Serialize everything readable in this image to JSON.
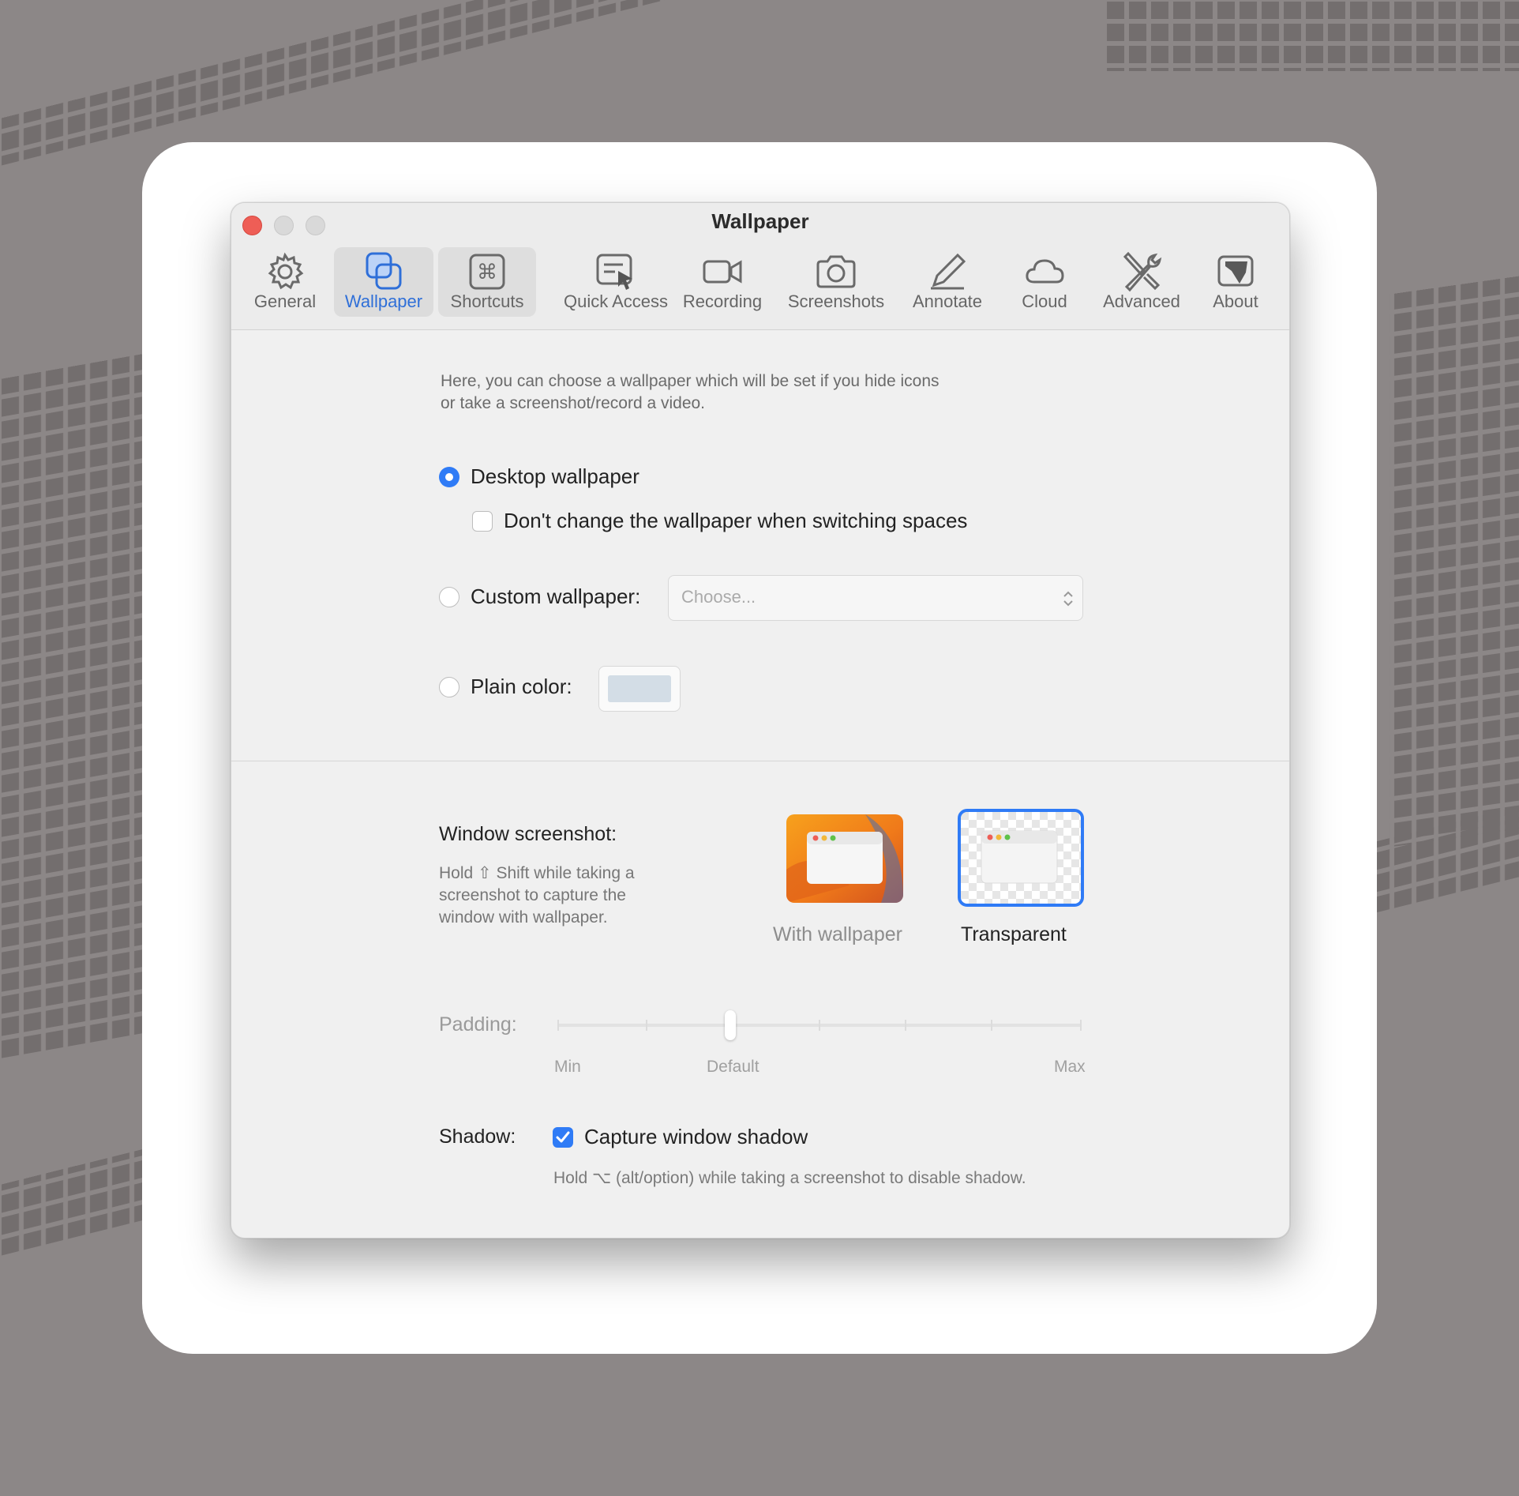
{
  "window": {
    "title": "Wallpaper"
  },
  "tabs": [
    {
      "label": "General",
      "icon": "gear-icon"
    },
    {
      "label": "Wallpaper",
      "icon": "wallpaper-icon",
      "active": true
    },
    {
      "label": "Shortcuts",
      "icon": "command-key-icon"
    },
    {
      "label": "Quick Access",
      "icon": "quick-access-icon"
    },
    {
      "label": "Recording",
      "icon": "video-camera-icon"
    },
    {
      "label": "Screenshots",
      "icon": "camera-icon"
    },
    {
      "label": "Annotate",
      "icon": "pencil-icon"
    },
    {
      "label": "Cloud",
      "icon": "cloud-icon"
    },
    {
      "label": "Advanced",
      "icon": "tools-icon"
    },
    {
      "label": "About",
      "icon": "about-icon"
    }
  ],
  "wallpaper": {
    "description_line1": "Here, you can choose a wallpaper which will be set if you hide icons",
    "description_line2": "or take a screenshot/record a video.",
    "desktop_label": "Desktop wallpaper",
    "no_change_label": "Don't change the wallpaper when switching spaces",
    "custom_label": "Custom wallpaper:",
    "custom_placeholder": "Choose...",
    "plain_label": "Plain color:",
    "plain_color": "#d3dde6",
    "selected": "desktop"
  },
  "window_screenshot": {
    "title": "Window screenshot:",
    "desc_line1": "Hold ⇧ Shift while taking a",
    "desc_line2": "screenshot to capture the",
    "desc_line3": "window with wallpaper.",
    "option_wallpaper": "With wallpaper",
    "option_transparent": "Transparent",
    "selected": "transparent"
  },
  "padding": {
    "label": "Padding:",
    "min_label": "Min",
    "default_label": "Default",
    "max_label": "Max",
    "value_fraction": 0.33
  },
  "shadow": {
    "label": "Shadow:",
    "checkbox_label": "Capture window shadow",
    "checked": true,
    "hint": "Hold ⌥ (alt/option) while taking a screenshot to disable shadow."
  },
  "colors": {
    "accent": "#2f7bf6",
    "close": "#ee5e56"
  }
}
